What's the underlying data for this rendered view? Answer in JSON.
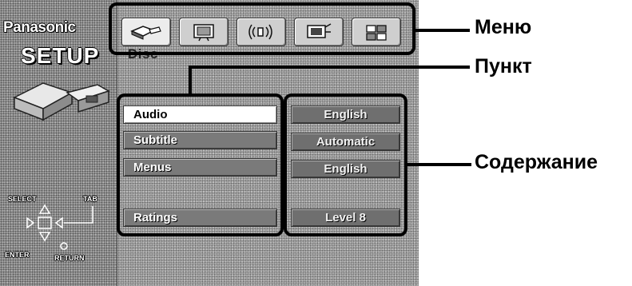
{
  "screen": {
    "brand": "Panasonic",
    "title": "SETUP",
    "heading": "Disc",
    "nav": {
      "select_label": "SELECT",
      "tab_label": "TAB",
      "enter_label": "ENTER",
      "return_label": "RETURN"
    }
  },
  "tabs": [
    {
      "icon": "disc-icon",
      "active": true
    },
    {
      "icon": "video-icon",
      "active": false
    },
    {
      "icon": "audio-icon",
      "active": false
    },
    {
      "icon": "display-icon",
      "active": false
    },
    {
      "icon": "others-icon",
      "active": false
    }
  ],
  "menu": {
    "items": [
      {
        "label": "Audio",
        "selected": true
      },
      {
        "label": "Subtitle",
        "selected": false
      },
      {
        "label": "Menus",
        "selected": false
      },
      {
        "label": "Ratings",
        "selected": false
      }
    ],
    "values": [
      "English",
      "Automatic",
      "English",
      "Level 8"
    ]
  },
  "annotations": {
    "menu": "Меню",
    "item": "Пункт",
    "content": "Содержание"
  },
  "colors": {
    "screen_bg": "#a9a9a9",
    "item_bg": "#7a7a7a",
    "item_selected_bg": "#ffffff",
    "callout": "#000000"
  }
}
